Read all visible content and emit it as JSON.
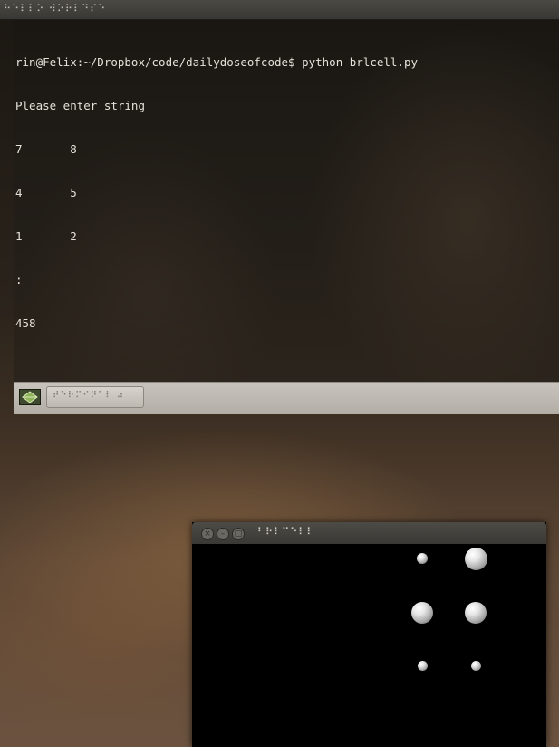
{
  "topbar": {
    "title": "⠓⠑⠇⠇⠕ ⠺⠕⠗⠇⠙⠎⠑"
  },
  "terminal": {
    "lines": [
      "rin@Felix:~/Dropbox/code/dailydoseofcode$ python brlcell.py",
      "Please enter string",
      "7       8",
      "4       5",
      "1       2",
      ":",
      "458"
    ]
  },
  "taskbar": {
    "task_label": "⠞⠑⠗⠍⠊⠝⠁⠇ ⠴"
  },
  "braille_window": {
    "title": "⠃⠗⠇⠉⠑⠇⠇",
    "buttons": [
      "×",
      "–",
      "□"
    ],
    "dots": [
      {
        "row": 1,
        "col": 1,
        "raised": false
      },
      {
        "row": 1,
        "col": 2,
        "raised": true
      },
      {
        "row": 2,
        "col": 1,
        "raised": true
      },
      {
        "row": 2,
        "col": 2,
        "raised": true
      },
      {
        "row": 3,
        "col": 1,
        "raised": false
      },
      {
        "row": 3,
        "col": 2,
        "raised": false
      }
    ]
  }
}
